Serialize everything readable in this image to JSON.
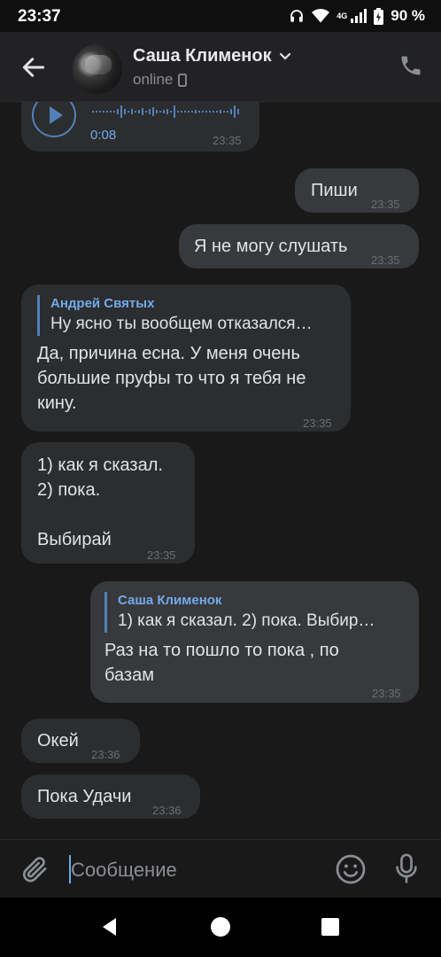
{
  "status_bar": {
    "time": "23:37",
    "network": "4G",
    "battery": "90 %"
  },
  "header": {
    "contact_name": "Саша Клименок",
    "presence": "online"
  },
  "messages": [
    {
      "type": "voice",
      "duration": "0:08",
      "time": "23:35",
      "direction": "in"
    },
    {
      "type": "text",
      "text": "Пиши",
      "time": "23:35",
      "direction": "out"
    },
    {
      "type": "text",
      "text": "Я не могу слушать",
      "time": "23:35",
      "direction": "out"
    },
    {
      "type": "reply",
      "reply_author": "Андрей Святых",
      "reply_text": "Ну ясно ты вообщем отказался…",
      "text": "Да, причина есна. У меня очень\nбольшие пруфы то что я тебя не\nкину.",
      "time": "23:35",
      "direction": "in"
    },
    {
      "type": "text",
      "text": "1) как я сказал.\n2) пока.\n\nВыбирай",
      "time": "23:35",
      "direction": "in"
    },
    {
      "type": "reply",
      "reply_author": "Саша Клименок",
      "reply_text": "1) как я сказал. 2) пока.  Выбир…",
      "text": "Раз на то пошло то пока , по\nбазам",
      "time": "23:35",
      "direction": "out"
    },
    {
      "type": "text",
      "text": "Окей",
      "time": "23:36",
      "direction": "in"
    },
    {
      "type": "text",
      "text": "Пока Удачи",
      "time": "23:36",
      "direction": "in"
    }
  ],
  "composer": {
    "placeholder": "Сообщение"
  },
  "colors": {
    "accent": "#71aaeb",
    "background": "#19191a",
    "bubble_in": "#2c2d2f",
    "bubble_out": "#38393c"
  }
}
